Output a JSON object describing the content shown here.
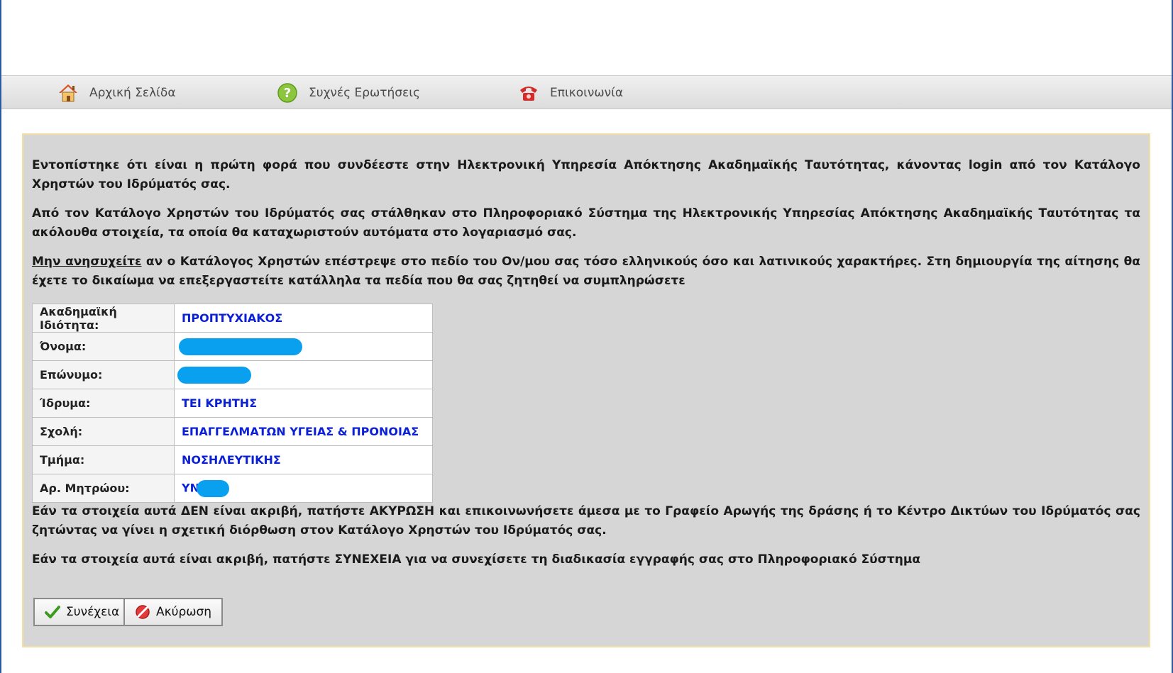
{
  "nav": {
    "home": "Αρχική Σελίδα",
    "faq": "Συχνές Ερωτήσεις",
    "contact": "Επικοινωνία"
  },
  "intro": {
    "p1": "Εντοπίστηκε ότι είναι η πρώτη φορά που συνδέεστε στην Ηλεκτρονική Υπηρεσία Απόκτησης Ακαδημαϊκής Ταυτότητας, κάνοντας login από τον Κατάλογο Χρηστών του Ιδρύματός σας.",
    "p2": "Από τον Κατάλογο Χρηστών του Ιδρύματός σας στάλθηκαν στο Πληροφοριακό Σύστημα της Ηλεκτρονικής Υπηρεσίας Απόκτησης Ακαδημαϊκής Ταυτότητας τα ακόλουθα στοιχεία, τα οποία θα καταχωριστούν αυτόματα στο λογαριασμό σας.",
    "p3_emph": "Μην ανησυχείτε",
    "p3_rest": " αν ο Κατάλογος Χρηστών επέστρεψε στο πεδίο του Ον/μου σας τόσο ελληνικούς όσο και λατινικούς χαρακτήρες. Στη δημιουργία της αίτησης θα έχετε το δικαίωμα να επεξεργαστείτε κατάλληλα τα πεδία που θα σας ζητηθεί να συμπληρώσετε"
  },
  "table": {
    "rows": [
      {
        "label": "Ακαδημαϊκή Ιδιότητα:",
        "value": "ΠΡΟΠΤΥΧΙΑΚΟΣ"
      },
      {
        "label": "Όνομα:",
        "value": ""
      },
      {
        "label": "Επώνυμο:",
        "value": ""
      },
      {
        "label": "Ίδρυμα:",
        "value": "ΤΕΙ ΚΡΗΤΗΣ"
      },
      {
        "label": "Σχολή:",
        "value": "ΕΠΑΓΓΕΛΜΑΤΩΝ ΥΓΕΙΑΣ & ΠΡΟΝΟΙΑΣ"
      },
      {
        "label": "Τμήμα:",
        "value": "ΝΟΣΗΛΕΥΤΙΚΗΣ"
      },
      {
        "label": "Αρ. Μητρώου:",
        "value": "ΥΝ"
      }
    ]
  },
  "outro": {
    "p4": "Εάν τα στοιχεία αυτά ΔΕΝ είναι ακριβή, πατήστε ΑΚΥΡΩΣΗ και επικοινωνήσετε άμεσα με το Γραφείο Αρωγής της δράσης ή το Κέντρο Δικτύων του Ιδρύματός σας ζητώντας να γίνει η σχετική διόρθωση στον Κατάλογο Χρηστών του Ιδρύματός σας.",
    "p5": "Εάν τα στοιχεία αυτά είναι ακριβή, πατήστε ΣΥΝΕΧΕΙΑ για να συνεχίσετε τη διαδικασία εγγραφής σας στο Πληροφοριακό Σύστημα"
  },
  "buttons": {
    "continue": "Συνέχεια",
    "cancel": "Ακύρωση"
  },
  "colors": {
    "panel_bg": "#d6d6d6",
    "panel_border": "#f2dfa3",
    "value_text": "#0a1fd6",
    "redaction": "#0aa0f0"
  }
}
